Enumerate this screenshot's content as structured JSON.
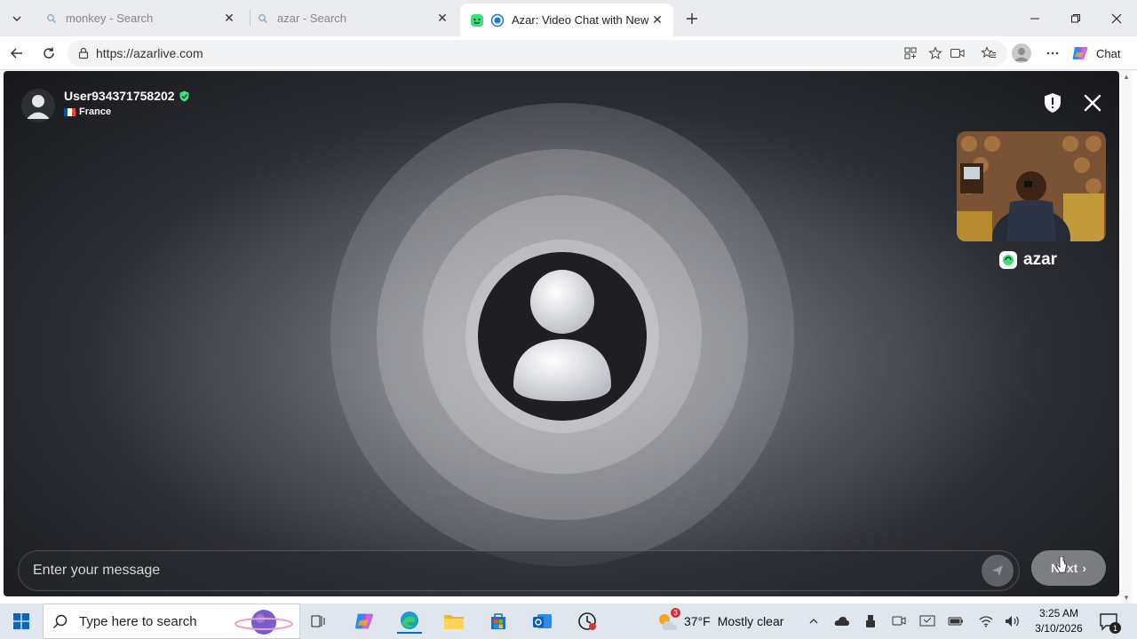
{
  "browser": {
    "tabs": [
      {
        "title": "monkey - Search",
        "icon": "search-favicon",
        "active": false
      },
      {
        "title": "azar - Search",
        "icon": "search-favicon",
        "active": false
      },
      {
        "title": "Azar: Video Chat with New Pe",
        "icon": "azar-favicon",
        "active": true
      }
    ],
    "url": "https://azarlive.com",
    "chat_label": "Chat"
  },
  "peer": {
    "username": "User934371758202",
    "country": "France",
    "verified": true
  },
  "brand": {
    "name": "azar",
    "accent": "#3ee07a"
  },
  "composer": {
    "placeholder": "Enter your message",
    "next_label": "Next"
  },
  "taskbar": {
    "search_placeholder": "Type here to search",
    "weather_badge": "3",
    "temperature": "37°F",
    "weather_text": "Mostly clear",
    "time": "3:25 AM",
    "date": "3/10/2026",
    "notification_count": "1"
  }
}
